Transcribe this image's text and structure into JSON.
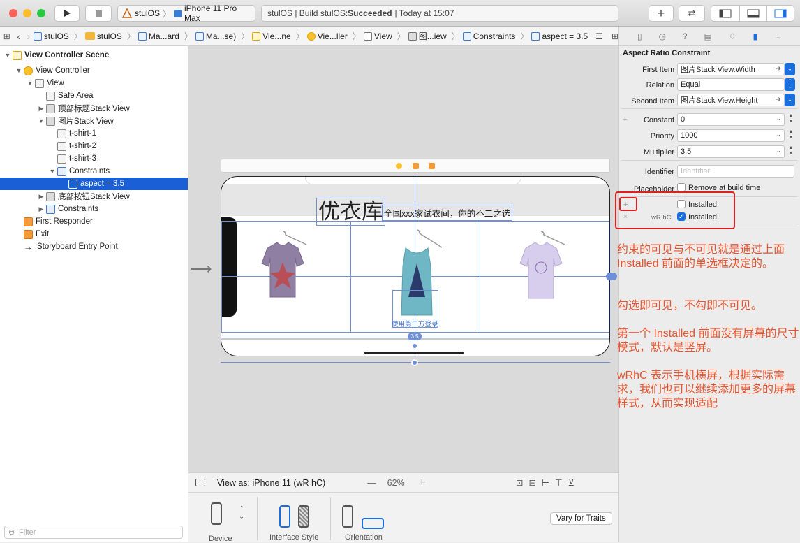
{
  "toolbar": {
    "scheme_app": "stulOS",
    "scheme_device": "iPhone 11 Pro Max",
    "status_prefix": "stulOS | Build stulOS: ",
    "status_result": "Succeeded",
    "status_time": "| Today at 15:07"
  },
  "jumpbar": {
    "crumbs": [
      "stulOS",
      "stulOS",
      "Ma...ard",
      "Ma...se)",
      "Vie...ne",
      "Vie...ller",
      "View",
      "图...iew",
      "Constraints",
      "aspect = 3.5"
    ]
  },
  "navigator": {
    "scene_title": "View Controller Scene",
    "rows": [
      "View Controller",
      "View",
      "Safe Area",
      "顶部标题Stack View",
      "图片Stack View",
      "t-shirt-1",
      "t-shirt-2",
      "t-shirt-3",
      "Constraints",
      "aspect = 3.5",
      "底部按钮Stack View",
      "Constraints",
      "First Responder",
      "Exit",
      "Storyboard Entry Point"
    ],
    "filter_placeholder": "Filter"
  },
  "canvas": {
    "title_big": "优衣库",
    "title_small": "全国xxx家试衣间，你的不二之选",
    "login_label": "使用第三方登录",
    "aspect_badge": "3.5",
    "view_as": "View as: iPhone 11 (wR hC)",
    "zoom": "62%",
    "vary_button": "Vary for Traits",
    "device_label": "Device",
    "interface_label": "Interface Style",
    "orientation_label": "Orientation"
  },
  "inspector": {
    "title": "Aspect Ratio Constraint",
    "first_item_label": "First Item",
    "first_item_value": "图片Stack View.Width",
    "relation_label": "Relation",
    "relation_value": "Equal",
    "second_item_label": "Second Item",
    "second_item_value": "图片Stack View.Height",
    "constant_label": "Constant",
    "constant_value": "0",
    "priority_label": "Priority",
    "priority_value": "1000",
    "multiplier_label": "Multiplier",
    "multiplier_value": "3.5",
    "identifier_label": "Identifier",
    "identifier_placeholder": "Identifier",
    "placeholder_label": "Placeholder",
    "placeholder_text": "Remove at build time",
    "installed_label": "Installed",
    "trait_label": "wR hC",
    "installed_default": false,
    "installed_wrhc": true
  },
  "annotations": [
    "约束的可见与不可见就是通过上面 Installed 前面的单选框决定的。",
    "勾选即可见，不勾即不可见。",
    "第一个 Installed 前面没有屏幕的尺寸模式，默认是竖屏。",
    "wRhC 表示手机横屏，根据实际需求，我们也可以继续添加更多的屏幕样式，从而实现适配"
  ],
  "colors": {
    "accent": "#1a5fd6",
    "annotation": "#e8542e",
    "highlight_box": "#e02020"
  }
}
